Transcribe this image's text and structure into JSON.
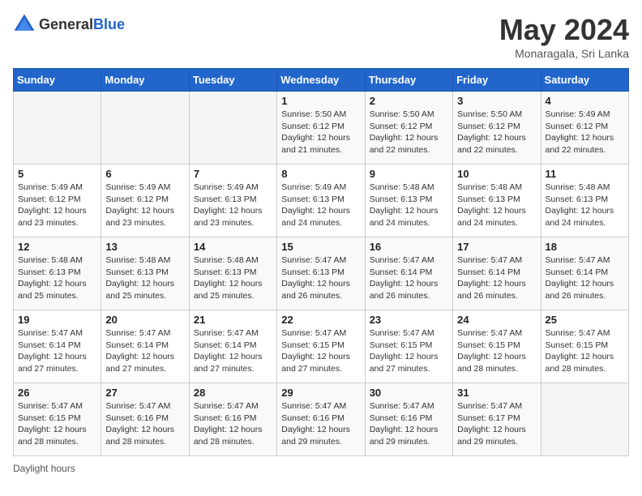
{
  "header": {
    "logo_general": "General",
    "logo_blue": "Blue",
    "month_year": "May 2024",
    "location": "Monaragala, Sri Lanka"
  },
  "days_of_week": [
    "Sunday",
    "Monday",
    "Tuesday",
    "Wednesday",
    "Thursday",
    "Friday",
    "Saturday"
  ],
  "weeks": [
    {
      "days": [
        {
          "num": "",
          "sunrise": "",
          "sunset": "",
          "daylight": ""
        },
        {
          "num": "",
          "sunrise": "",
          "sunset": "",
          "daylight": ""
        },
        {
          "num": "",
          "sunrise": "",
          "sunset": "",
          "daylight": ""
        },
        {
          "num": "1",
          "sunrise": "Sunrise: 5:50 AM",
          "sunset": "Sunset: 6:12 PM",
          "daylight": "Daylight: 12 hours and 21 minutes."
        },
        {
          "num": "2",
          "sunrise": "Sunrise: 5:50 AM",
          "sunset": "Sunset: 6:12 PM",
          "daylight": "Daylight: 12 hours and 22 minutes."
        },
        {
          "num": "3",
          "sunrise": "Sunrise: 5:50 AM",
          "sunset": "Sunset: 6:12 PM",
          "daylight": "Daylight: 12 hours and 22 minutes."
        },
        {
          "num": "4",
          "sunrise": "Sunrise: 5:49 AM",
          "sunset": "Sunset: 6:12 PM",
          "daylight": "Daylight: 12 hours and 22 minutes."
        }
      ]
    },
    {
      "days": [
        {
          "num": "5",
          "sunrise": "Sunrise: 5:49 AM",
          "sunset": "Sunset: 6:12 PM",
          "daylight": "Daylight: 12 hours and 23 minutes."
        },
        {
          "num": "6",
          "sunrise": "Sunrise: 5:49 AM",
          "sunset": "Sunset: 6:12 PM",
          "daylight": "Daylight: 12 hours and 23 minutes."
        },
        {
          "num": "7",
          "sunrise": "Sunrise: 5:49 AM",
          "sunset": "Sunset: 6:13 PM",
          "daylight": "Daylight: 12 hours and 23 minutes."
        },
        {
          "num": "8",
          "sunrise": "Sunrise: 5:49 AM",
          "sunset": "Sunset: 6:13 PM",
          "daylight": "Daylight: 12 hours and 24 minutes."
        },
        {
          "num": "9",
          "sunrise": "Sunrise: 5:48 AM",
          "sunset": "Sunset: 6:13 PM",
          "daylight": "Daylight: 12 hours and 24 minutes."
        },
        {
          "num": "10",
          "sunrise": "Sunrise: 5:48 AM",
          "sunset": "Sunset: 6:13 PM",
          "daylight": "Daylight: 12 hours and 24 minutes."
        },
        {
          "num": "11",
          "sunrise": "Sunrise: 5:48 AM",
          "sunset": "Sunset: 6:13 PM",
          "daylight": "Daylight: 12 hours and 24 minutes."
        }
      ]
    },
    {
      "days": [
        {
          "num": "12",
          "sunrise": "Sunrise: 5:48 AM",
          "sunset": "Sunset: 6:13 PM",
          "daylight": "Daylight: 12 hours and 25 minutes."
        },
        {
          "num": "13",
          "sunrise": "Sunrise: 5:48 AM",
          "sunset": "Sunset: 6:13 PM",
          "daylight": "Daylight: 12 hours and 25 minutes."
        },
        {
          "num": "14",
          "sunrise": "Sunrise: 5:48 AM",
          "sunset": "Sunset: 6:13 PM",
          "daylight": "Daylight: 12 hours and 25 minutes."
        },
        {
          "num": "15",
          "sunrise": "Sunrise: 5:47 AM",
          "sunset": "Sunset: 6:13 PM",
          "daylight": "Daylight: 12 hours and 26 minutes."
        },
        {
          "num": "16",
          "sunrise": "Sunrise: 5:47 AM",
          "sunset": "Sunset: 6:14 PM",
          "daylight": "Daylight: 12 hours and 26 minutes."
        },
        {
          "num": "17",
          "sunrise": "Sunrise: 5:47 AM",
          "sunset": "Sunset: 6:14 PM",
          "daylight": "Daylight: 12 hours and 26 minutes."
        },
        {
          "num": "18",
          "sunrise": "Sunrise: 5:47 AM",
          "sunset": "Sunset: 6:14 PM",
          "daylight": "Daylight: 12 hours and 26 minutes."
        }
      ]
    },
    {
      "days": [
        {
          "num": "19",
          "sunrise": "Sunrise: 5:47 AM",
          "sunset": "Sunset: 6:14 PM",
          "daylight": "Daylight: 12 hours and 27 minutes."
        },
        {
          "num": "20",
          "sunrise": "Sunrise: 5:47 AM",
          "sunset": "Sunset: 6:14 PM",
          "daylight": "Daylight: 12 hours and 27 minutes."
        },
        {
          "num": "21",
          "sunrise": "Sunrise: 5:47 AM",
          "sunset": "Sunset: 6:14 PM",
          "daylight": "Daylight: 12 hours and 27 minutes."
        },
        {
          "num": "22",
          "sunrise": "Sunrise: 5:47 AM",
          "sunset": "Sunset: 6:15 PM",
          "daylight": "Daylight: 12 hours and 27 minutes."
        },
        {
          "num": "23",
          "sunrise": "Sunrise: 5:47 AM",
          "sunset": "Sunset: 6:15 PM",
          "daylight": "Daylight: 12 hours and 27 minutes."
        },
        {
          "num": "24",
          "sunrise": "Sunrise: 5:47 AM",
          "sunset": "Sunset: 6:15 PM",
          "daylight": "Daylight: 12 hours and 28 minutes."
        },
        {
          "num": "25",
          "sunrise": "Sunrise: 5:47 AM",
          "sunset": "Sunset: 6:15 PM",
          "daylight": "Daylight: 12 hours and 28 minutes."
        }
      ]
    },
    {
      "days": [
        {
          "num": "26",
          "sunrise": "Sunrise: 5:47 AM",
          "sunset": "Sunset: 6:15 PM",
          "daylight": "Daylight: 12 hours and 28 minutes."
        },
        {
          "num": "27",
          "sunrise": "Sunrise: 5:47 AM",
          "sunset": "Sunset: 6:16 PM",
          "daylight": "Daylight: 12 hours and 28 minutes."
        },
        {
          "num": "28",
          "sunrise": "Sunrise: 5:47 AM",
          "sunset": "Sunset: 6:16 PM",
          "daylight": "Daylight: 12 hours and 28 minutes."
        },
        {
          "num": "29",
          "sunrise": "Sunrise: 5:47 AM",
          "sunset": "Sunset: 6:16 PM",
          "daylight": "Daylight: 12 hours and 29 minutes."
        },
        {
          "num": "30",
          "sunrise": "Sunrise: 5:47 AM",
          "sunset": "Sunset: 6:16 PM",
          "daylight": "Daylight: 12 hours and 29 minutes."
        },
        {
          "num": "31",
          "sunrise": "Sunrise: 5:47 AM",
          "sunset": "Sunset: 6:17 PM",
          "daylight": "Daylight: 12 hours and 29 minutes."
        },
        {
          "num": "",
          "sunrise": "",
          "sunset": "",
          "daylight": ""
        }
      ]
    }
  ],
  "footer": {
    "daylight_label": "Daylight hours"
  }
}
